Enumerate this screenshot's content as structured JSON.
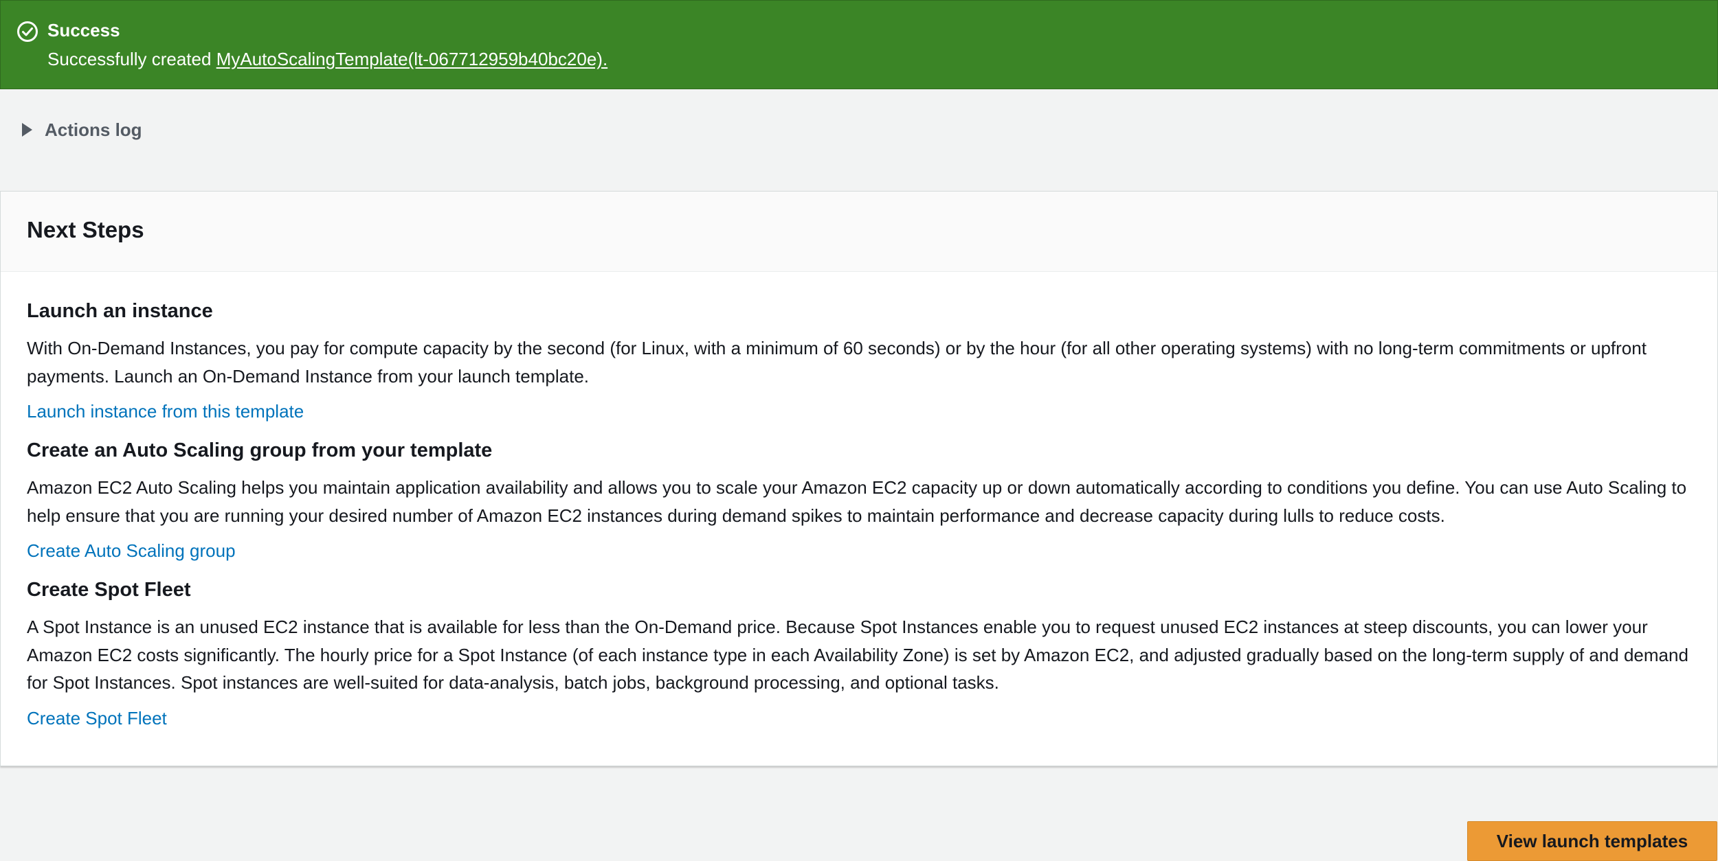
{
  "flash": {
    "status": "success",
    "color": "#3b8526",
    "icon": "check-circle-icon",
    "title": "Success",
    "message_prefix": "Successfully created",
    "message_link": "MyAutoScalingTemplate(lt-067712959b40bc20e)."
  },
  "actions_log": {
    "icon": "caret-right-icon",
    "label": "Actions log"
  },
  "next_steps": {
    "title": "Next Steps",
    "steps": [
      {
        "title": "Launch an instance",
        "description": "With On-Demand Instances, you pay for compute capacity by the second (for Linux, with a minimum of 60 seconds) or by the hour (for all other operating systems) with no long-term commitments or upfront payments. Launch an On-Demand Instance from your launch template.",
        "link": "Launch instance from this template"
      },
      {
        "title": "Create an Auto Scaling group from your template",
        "description": "Amazon EC2 Auto Scaling helps you maintain application availability and allows you to scale your Amazon EC2 capacity up or down automatically according to conditions you define. You can use Auto Scaling to help ensure that you are running your desired number of Amazon EC2 instances during demand spikes to maintain performance and decrease capacity during lulls to reduce costs.",
        "link": "Create Auto Scaling group"
      },
      {
        "title": "Create Spot Fleet",
        "description": "A Spot Instance is an unused EC2 instance that is available for less than the On-Demand price. Because Spot Instances enable you to request unused EC2 instances at steep discounts, you can lower your Amazon EC2 costs significantly. The hourly price for a Spot Instance (of each instance type in each Availability Zone) is set by Amazon EC2, and adjusted gradually based on the long-term supply of and demand for Spot Instances. Spot instances are well-suited for data-analysis, batch jobs, background processing, and optional tasks.",
        "link": "Create Spot Fleet"
      }
    ]
  },
  "footer": {
    "primary_button_label": "View launch templates",
    "primary_button_color": "#ec9a35"
  },
  "colors": {
    "link": "#0073bb",
    "page_background": "#f2f3f3"
  }
}
